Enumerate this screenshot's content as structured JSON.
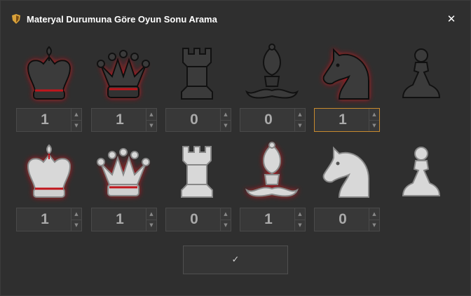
{
  "window": {
    "title": "Materyal Durumuna Göre Oyun Sonu Arama",
    "close_glyph": "✕"
  },
  "black_row": [
    {
      "piece": "king",
      "icon": "black-king-icon",
      "count": "1",
      "highlighted": true
    },
    {
      "piece": "queen",
      "icon": "black-queen-icon",
      "count": "1",
      "highlighted": true
    },
    {
      "piece": "rook",
      "icon": "black-rook-icon",
      "count": "0",
      "highlighted": false
    },
    {
      "piece": "bishop",
      "icon": "black-bishop-icon",
      "count": "0",
      "highlighted": false
    },
    {
      "piece": "knight",
      "icon": "black-knight-icon",
      "count": "1",
      "highlighted": true,
      "focused": true
    },
    {
      "piece": "pawn",
      "icon": "black-pawn-icon",
      "count": null,
      "highlighted": false
    }
  ],
  "white_row": [
    {
      "piece": "king",
      "icon": "white-king-icon",
      "count": "1",
      "highlighted": true
    },
    {
      "piece": "queen",
      "icon": "white-queen-icon",
      "count": "1",
      "highlighted": true
    },
    {
      "piece": "rook",
      "icon": "white-rook-icon",
      "count": "0",
      "highlighted": false
    },
    {
      "piece": "bishop",
      "icon": "white-bishop-icon",
      "count": "1",
      "highlighted": true
    },
    {
      "piece": "knight",
      "icon": "white-knight-icon",
      "count": "0",
      "highlighted": false
    },
    {
      "piece": "pawn",
      "icon": "white-pawn-icon",
      "count": null,
      "highlighted": false
    }
  ],
  "spinner": {
    "up_glyph": "▲",
    "down_glyph": "▼"
  },
  "ok_button": {
    "label": "✓"
  },
  "colors": {
    "background": "#2f2f2f",
    "highlight_glow": "#c0141c",
    "focus_border": "#c88a2e",
    "black_piece": "#3a3a3a",
    "white_piece": "#d8d8d8"
  }
}
